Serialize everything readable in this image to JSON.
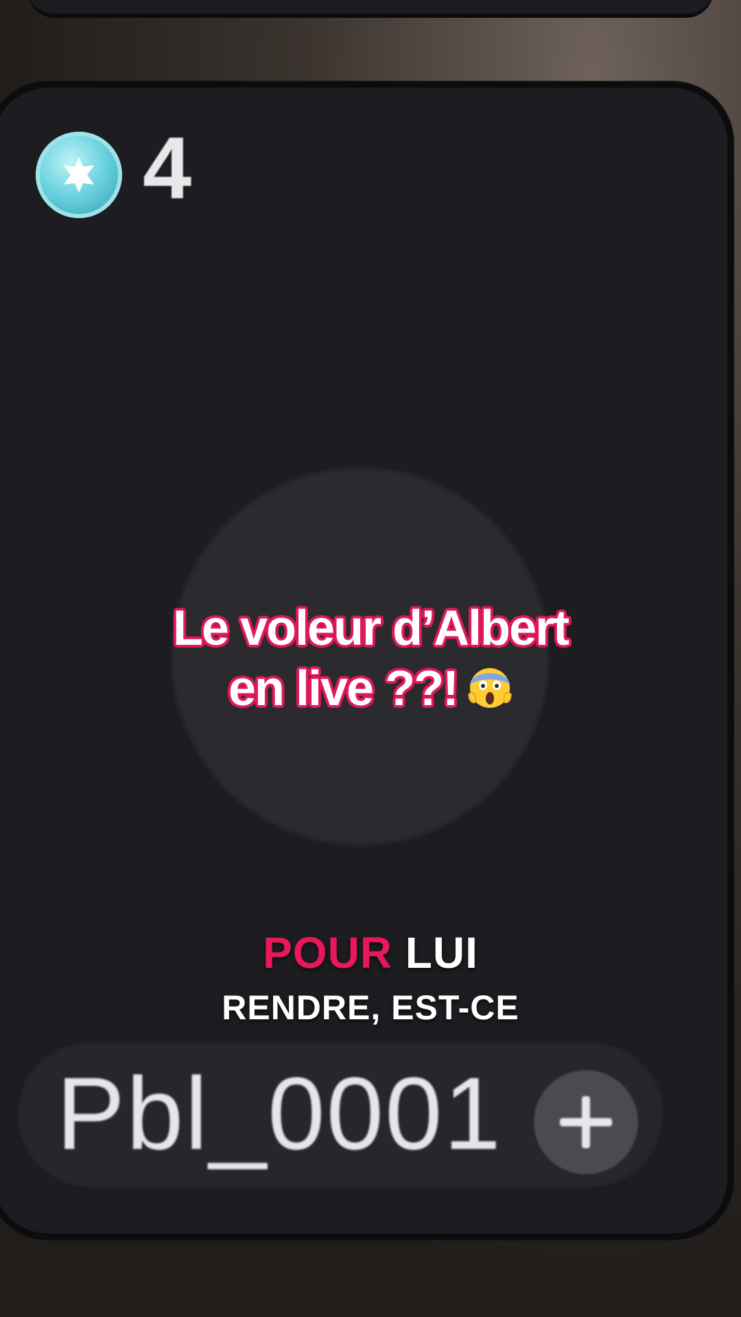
{
  "profile_card": {
    "gem_icon": "gem-badge-icon",
    "gem_count": "4",
    "username": "Pbl_0001",
    "add_icon": "plus-icon"
  },
  "overlay": {
    "title_line1": "Le voleur d’Albert",
    "title_line2": "en live ??!",
    "title_emoji": "screaming-face-emoji"
  },
  "subtitles": {
    "line1_accent": "POUR",
    "line1_rest": "LUI",
    "line2": "RENDRE, EST-CE"
  },
  "colors": {
    "accent": "#e8185a",
    "card": "#1d1d21",
    "gem": "#6ad2df"
  }
}
